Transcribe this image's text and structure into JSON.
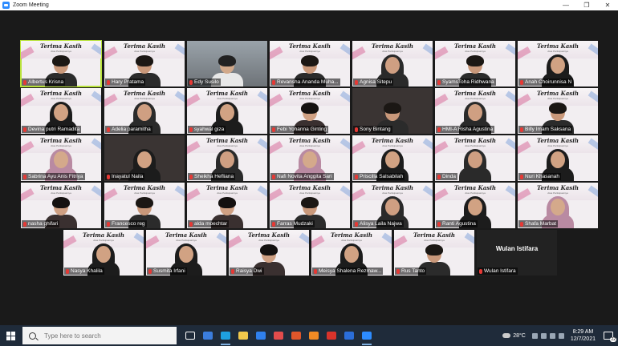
{
  "window": {
    "title": "Zoom Meeting",
    "min": "—",
    "max": "❐",
    "close": "✕"
  },
  "participants": [
    {
      "name": "Albertus Krisna",
      "speaking": true,
      "look": "m1"
    },
    {
      "name": "Hary Pratama",
      "look": "m1"
    },
    {
      "name": "Edy Susilo",
      "look": "m2",
      "bg": "trees"
    },
    {
      "name": "Revansha Ananda Muha...",
      "look": "m1"
    },
    {
      "name": "Agnisa Sitepu",
      "look": "h2"
    },
    {
      "name": "SyamsToha Ridhwana",
      "look": "m1"
    },
    {
      "name": "Anah Choirunnisa N",
      "look": "h1"
    },
    {
      "name": "Devina putri Ramadita",
      "look": "h1"
    },
    {
      "name": "Adelia paramitha",
      "look": "h2"
    },
    {
      "name": "syahwal giza",
      "look": "h1"
    },
    {
      "name": "Febi Yohanna Ginting",
      "look": "f"
    },
    {
      "name": "Sony Bintang",
      "look": "m1",
      "bg": "dark"
    },
    {
      "name": "HMI-A Risha Agustina",
      "look": "h2"
    },
    {
      "name": "Billy Imam Saksana",
      "look": "m1"
    },
    {
      "name": "Sabrina Ayu Anis Fitriya",
      "look": "h3"
    },
    {
      "name": "Inayatul Naila",
      "look": "h1",
      "bg": "dark"
    },
    {
      "name": "Sheikha Hefliana",
      "look": "h2"
    },
    {
      "name": "Nafi Novita Anggita Sari",
      "look": "h3"
    },
    {
      "name": "Priscilla Salsabilah",
      "look": "h1"
    },
    {
      "name": "Dinda",
      "look": "h2"
    },
    {
      "name": "Nuri Khasanah",
      "look": "h1"
    },
    {
      "name": "nasha ghifari",
      "look": "f"
    },
    {
      "name": "Francesco reg",
      "look": "m1"
    },
    {
      "name": "alda moechtar",
      "look": "f"
    },
    {
      "name": "Farras Mudzaki",
      "look": "m1"
    },
    {
      "name": "Alisya Laila Najwa",
      "look": "h2"
    },
    {
      "name": "Ranti Agustina",
      "look": "h1"
    },
    {
      "name": "Shafa Marbat",
      "look": "h3"
    },
    {
      "name": "Nasya Khalila",
      "look": "h1"
    },
    {
      "name": "Susmita Irfani",
      "look": "h1"
    },
    {
      "name": "Raisya Dwi",
      "look": "f"
    },
    {
      "name": "Meisya Shalena Rezmaw...",
      "look": "h1"
    },
    {
      "name": "Rus Tanto",
      "look": "m1"
    },
    {
      "name": "Wulan Istifara",
      "look": "none",
      "camera_off": true
    }
  ],
  "tile_text": {
    "title": "Terima Kasih",
    "subtitle": "Atas Partisipasinya"
  },
  "taskbar": {
    "search_placeholder": "Type here to search",
    "weather": "28°C",
    "time": "8:29 AM",
    "date": "12/7/2021",
    "notifications": "22",
    "apps": [
      "task-view-icon",
      "mail-icon",
      "edge-icon",
      "file-explorer-icon",
      "store-icon",
      "gift-icon",
      "office-icon",
      "firefox-icon",
      "vivaldi-icon",
      "generic-app-icon",
      "zoom-icon"
    ],
    "app_colors": [
      "#ffffff",
      "#3b7ddd",
      "#1ea0e0",
      "#f2c94c",
      "#2f80ed",
      "#e24c4c",
      "#e0562b",
      "#f08a24",
      "#d9332b",
      "#2b6ed9",
      "#2d8cff"
    ]
  }
}
